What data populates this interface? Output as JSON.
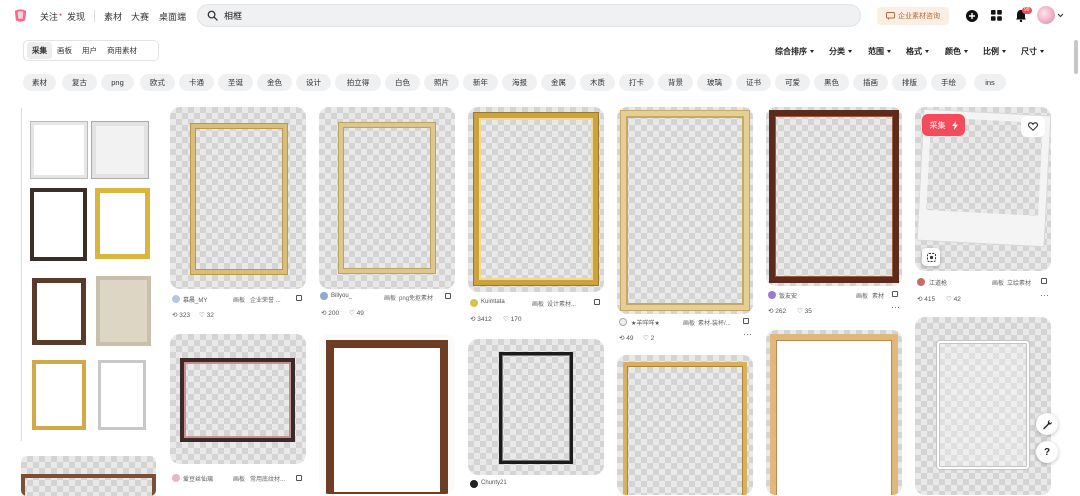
{
  "header": {
    "nav": [
      "关注",
      "发现",
      "素材",
      "大赛",
      "桌面端"
    ],
    "search_value": "相框",
    "corp_label": "企业素材咨询",
    "notification_count": "99"
  },
  "filters": {
    "tabs": [
      "采集",
      "画板",
      "用户",
      "商用素材"
    ],
    "active_tab": "采集",
    "sorts": [
      "综合排序",
      "分类",
      "范围",
      "格式",
      "颜色",
      "比例",
      "尺寸"
    ]
  },
  "tags": [
    "素材",
    "复古",
    "png",
    "欧式",
    "卡通",
    "圣诞",
    "金色",
    "设计",
    "拍立得",
    "白色",
    "照片",
    "新年",
    "海报",
    "金属",
    "木质",
    "打卡",
    "背景",
    "玻璃",
    "证书",
    "可爱",
    "黑色",
    "插画",
    "排版",
    "手绘",
    "ins"
  ],
  "cards": [
    {
      "user": "慕晨_MY",
      "board_prefix": "画板",
      "board": "企业荣誉 ...",
      "saves": "323",
      "likes": "32"
    },
    {
      "user": "Billyou_",
      "board_prefix": "画板",
      "board": "png免抠素材",
      "saves": "200",
      "likes": "49"
    },
    {
      "user": "Kuimtata",
      "board_prefix": "画板",
      "board": "设计素材...",
      "saves": "3412",
      "likes": "170"
    },
    {
      "user": "★羊咩咩★",
      "board_prefix": "画板",
      "board": "素材-装杯/...",
      "saves": "49",
      "likes": "2"
    },
    {
      "user": "饭友安",
      "board_prefix": "画板",
      "board": "素材",
      "saves": "262",
      "likes": "35"
    },
    {
      "user": "江道枪",
      "board_prefix": "画板",
      "board": "立绘素材",
      "saves": "415",
      "likes": "42"
    },
    {
      "user": "爱豆丝仙璃",
      "board_prefix": "画板",
      "board": "常用底纹材..."
    },
    {
      "user": "Chunty21"
    }
  ],
  "hover": {
    "collect_label": "采集"
  },
  "float": {
    "help_label": "?"
  },
  "colors": {
    "accent": "#f34b5c",
    "tag_bg": "#eff0f2",
    "corp_bg": "#fbeee2"
  }
}
